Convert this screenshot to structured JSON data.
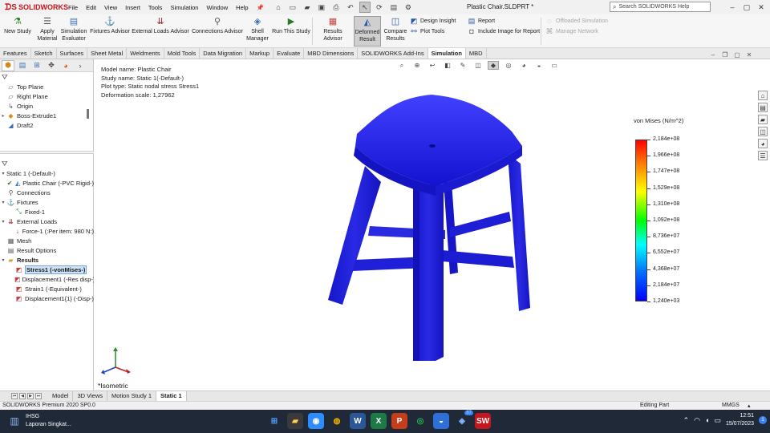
{
  "app": {
    "brand": "SOLIDWORKS",
    "document_title": "Plastic Chair.SLDPRT *",
    "help_search_placeholder": "Search SOLIDWORKS Help",
    "menu": [
      "File",
      "Edit",
      "View",
      "Insert",
      "Tools",
      "Simulation",
      "Window",
      "Help"
    ]
  },
  "ribbon": {
    "new_study": "New Study",
    "apply_material": [
      "Apply",
      "Material"
    ],
    "simulation_evaluator": [
      "Simulation",
      "Evaluator"
    ],
    "fixtures_advisor": "Fixtures Advisor",
    "external_loads_advisor": "External Loads Advisor",
    "connections_advisor": "Connections Advisor",
    "shell_manager": [
      "Shell",
      "Manager"
    ],
    "run_this_study": "Run This Study",
    "results_advisor": "Results Advisor",
    "deformed_result": [
      "Deformed",
      "Result"
    ],
    "compare_results": [
      "Compare",
      "Results"
    ],
    "design_insight": "Design Insight",
    "plot_tools": "Plot Tools",
    "report": "Report",
    "include_image_for_report": "Include Image for Report",
    "offloaded_simulation": "Offloaded Simulation",
    "manage_network": "Manage Network"
  },
  "tabs": [
    "Features",
    "Sketch",
    "Surfaces",
    "Sheet Metal",
    "Weldments",
    "Mold Tools",
    "Data Migration",
    "Markup",
    "Evaluate",
    "MBD Dimensions",
    "SOLIDWORKS Add-Ins",
    "Simulation",
    "MBD"
  ],
  "active_tab": "Simulation",
  "feature_tree": {
    "items": [
      {
        "label": "Top Plane",
        "icon": "plane-icon"
      },
      {
        "label": "Right Plane",
        "icon": "plane-icon"
      },
      {
        "label": "Origin",
        "icon": "origin-icon"
      },
      {
        "label": "Boss-Extrude1",
        "icon": "extrude-icon"
      },
      {
        "label": "Draft2",
        "icon": "draft-icon"
      }
    ]
  },
  "study_tree": {
    "study": "Static 1 (-Default-)",
    "part": "Plastic Chair (-PVC Rigid-)",
    "connections": "Connections",
    "fixtures": "Fixtures",
    "fixed": "Fixed-1",
    "external_loads": "External Loads",
    "force": "Force-1 (:Per item: 980 N:)",
    "mesh": "Mesh",
    "result_options": "Result Options",
    "results": "Results",
    "result_items": [
      "Stress1 (-vonMises-)",
      "Displacement1 (-Res disp-)",
      "Strain1 (-Equivalent-)",
      "Displacement1{1} (-Disp-)"
    ]
  },
  "study_info": {
    "model_name": "Model name: Plastic Chair",
    "study_name": "Study name: Static 1(-Default-)",
    "plot_type": "Plot type: Static nodal stress Stress1",
    "deformation_scale": "Deformation scale: 1,27962"
  },
  "view_name": "*Isometric",
  "legend": {
    "title": "von Mises (N/m^2)",
    "values": [
      "2,184e+08",
      "1,966e+08",
      "1,747e+08",
      "1,529e+08",
      "1,310e+08",
      "1,092e+08",
      "8,736e+07",
      "6,552e+07",
      "4,368e+07",
      "2,184e+07",
      "1,240e+03"
    ],
    "max": 218400000,
    "min": 1240,
    "plot_color": "#1e1ee0",
    "max_color": "#ff0000",
    "min_color": "#0000ff"
  },
  "bottom_tabs": [
    "Model",
    "3D Views",
    "Motion Study 1",
    "Static 1"
  ],
  "active_bottom_tab": "Static 1",
  "status_bar": {
    "product": "SOLIDWORKS Premium 2020 SP0.0",
    "mode": "Editing Part",
    "units": "MMGS"
  },
  "taskbar": {
    "weather_title": "IHSG",
    "weather_sub": "Laporan Singkat...",
    "time": "12:51",
    "date": "15/07/2023",
    "notification_count": "1",
    "badge_count": "87",
    "apps": [
      "start-icon",
      "search-icon",
      "file-explorer-icon",
      "zoom-icon",
      "chrome-icon",
      "word-icon",
      "excel-icon",
      "powerpoint-icon",
      "spotify-icon",
      "solidworks-app-icon",
      "store-icon",
      "solidworks-2020-icon"
    ]
  }
}
